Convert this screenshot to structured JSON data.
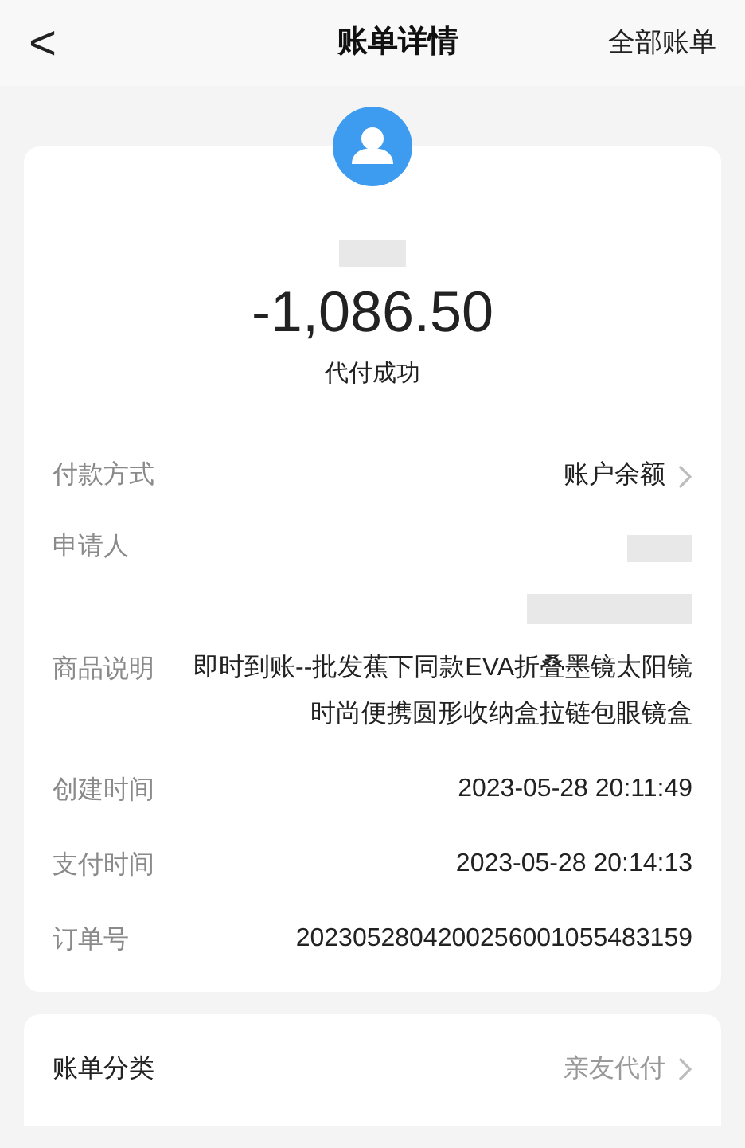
{
  "header": {
    "back": "<",
    "title": "账单详情",
    "action": "全部账单"
  },
  "summary": {
    "amount": "-1,086.50",
    "status": "代付成功"
  },
  "rows": [
    {
      "kind": "link",
      "label": "付款方式",
      "value": "账户余额"
    },
    {
      "kind": "redacted",
      "label": "申请人"
    },
    {
      "kind": "text",
      "label": "商品说明",
      "value": "即时到账--批发蕉下同款EVA折叠墨镜太阳镜时尚便携圆形收纳盒拉链包眼镜盒"
    },
    {
      "kind": "text",
      "label": "创建时间",
      "value": "2023-05-28 20:11:49"
    },
    {
      "kind": "text",
      "label": "支付时间",
      "value": "2023-05-28 20:14:13"
    },
    {
      "kind": "text",
      "label": "订单号",
      "value": "2023052804200256001055483159"
    }
  ],
  "category": {
    "label": "账单分类",
    "value": "亲友代付"
  }
}
